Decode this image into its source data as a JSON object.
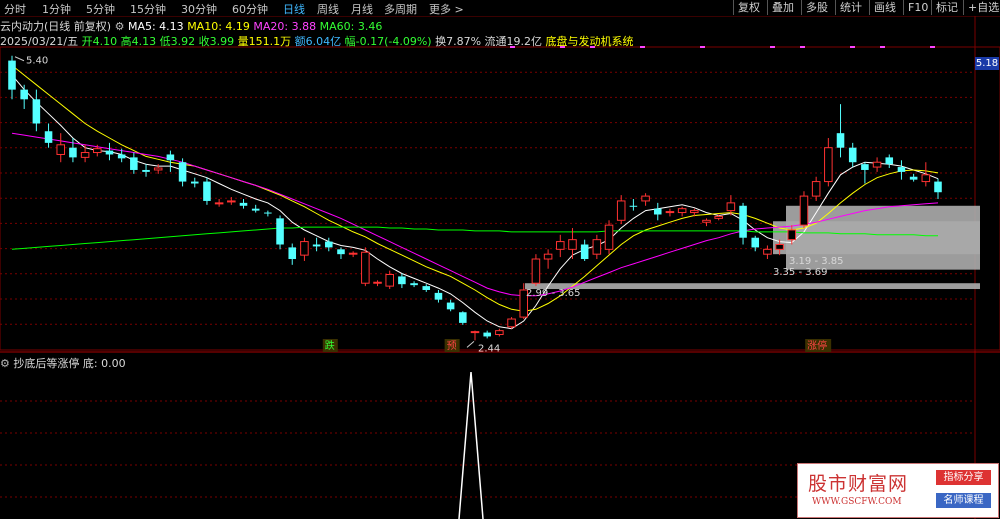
{
  "toolbar": {
    "periods": [
      "分时",
      "1分钟",
      "5分钟",
      "15分钟",
      "30分钟",
      "60分钟",
      "日线",
      "周线",
      "月线",
      "多周期",
      "更多 >"
    ],
    "active_period": "日线",
    "right_buttons": [
      "复权",
      "叠加",
      "多股",
      "统计",
      "画线",
      "F10",
      "标记",
      "+自选"
    ]
  },
  "header": {
    "indicator_name": "云内动力(日线 前复权)",
    "ma5": "MA5: 4.13",
    "ma10": "MA10: 4.19",
    "ma20": "MA20: 3.88",
    "ma60": "MA60: 3.46",
    "date": "2025/03/21/五",
    "open": "开4.10",
    "high": "高4.13",
    "low": "低3.92",
    "close": "收3.99",
    "volume": "量151.1万",
    "amount": "额6.04亿",
    "change": "幅-0.17(-4.09%)",
    "turnover": "换7.87%",
    "float_cap": "流通19.2亿",
    "system_label": "底盘与发动机系统"
  },
  "price_tag": "5.18",
  "annotations": {
    "high_label": "5.40",
    "low_label": "2.44",
    "zone1": "2.99 - 3.65",
    "zone2": "3.19 - 3.85",
    "zone3": "3.35 - 3.69",
    "sig_die": "跌",
    "sig_yu": "预",
    "sig_zhangting": "涨停"
  },
  "sub_panel": {
    "title": "抄底后等涨停",
    "value": "底: 0.00"
  },
  "watermark": {
    "main": "股市财富网",
    "url": "WWW.GSCFW.COM",
    "badge1": "指标分享",
    "badge2": "名师课程"
  },
  "colors": {
    "up": "#ff3232",
    "down": "#54ffff",
    "ma5": "#ffffff",
    "ma10": "#ffff00",
    "ma20": "#ff00ff",
    "ma60": "#00ff00",
    "grid": "#7a0000",
    "active": "#3fb8ff"
  },
  "chart_data": {
    "type": "candlestick",
    "candles": [
      {
        "o": 5.35,
        "h": 5.4,
        "l": 4.95,
        "c": 5.05
      },
      {
        "o": 5.05,
        "h": 5.1,
        "l": 4.85,
        "c": 4.95
      },
      {
        "o": 4.95,
        "h": 5.05,
        "l": 4.62,
        "c": 4.7
      },
      {
        "o": 4.62,
        "h": 4.7,
        "l": 4.45,
        "c": 4.5
      },
      {
        "o": 4.38,
        "h": 4.6,
        "l": 4.3,
        "c": 4.48
      },
      {
        "o": 4.45,
        "h": 4.55,
        "l": 4.3,
        "c": 4.35
      },
      {
        "o": 4.35,
        "h": 4.48,
        "l": 4.3,
        "c": 4.4
      },
      {
        "o": 4.4,
        "h": 4.48,
        "l": 4.36,
        "c": 4.44
      },
      {
        "o": 4.42,
        "h": 4.5,
        "l": 4.32,
        "c": 4.38
      },
      {
        "o": 4.38,
        "h": 4.44,
        "l": 4.3,
        "c": 4.34
      },
      {
        "o": 4.35,
        "h": 4.4,
        "l": 4.18,
        "c": 4.22
      },
      {
        "o": 4.22,
        "h": 4.28,
        "l": 4.15,
        "c": 4.2
      },
      {
        "o": 4.22,
        "h": 4.28,
        "l": 4.18,
        "c": 4.24
      },
      {
        "o": 4.38,
        "h": 4.42,
        "l": 4.2,
        "c": 4.32
      },
      {
        "o": 4.3,
        "h": 4.34,
        "l": 4.05,
        "c": 4.1
      },
      {
        "o": 4.1,
        "h": 4.14,
        "l": 4.04,
        "c": 4.08
      },
      {
        "o": 4.1,
        "h": 4.14,
        "l": 3.86,
        "c": 3.9
      },
      {
        "o": 3.88,
        "h": 3.92,
        "l": 3.84,
        "c": 3.88
      },
      {
        "o": 3.9,
        "h": 3.94,
        "l": 3.86,
        "c": 3.9
      },
      {
        "o": 3.88,
        "h": 3.92,
        "l": 3.82,
        "c": 3.85
      },
      {
        "o": 3.82,
        "h": 3.86,
        "l": 3.78,
        "c": 3.8
      },
      {
        "o": 3.78,
        "h": 3.8,
        "l": 3.74,
        "c": 3.77
      },
      {
        "o": 3.72,
        "h": 3.75,
        "l": 3.4,
        "c": 3.45
      },
      {
        "o": 3.42,
        "h": 3.46,
        "l": 3.24,
        "c": 3.3
      },
      {
        "o": 3.34,
        "h": 3.52,
        "l": 3.28,
        "c": 3.48
      },
      {
        "o": 3.45,
        "h": 3.52,
        "l": 3.38,
        "c": 3.43
      },
      {
        "o": 3.48,
        "h": 3.52,
        "l": 3.38,
        "c": 3.42
      },
      {
        "o": 3.4,
        "h": 3.42,
        "l": 3.3,
        "c": 3.35
      },
      {
        "o": 3.36,
        "h": 3.38,
        "l": 3.32,
        "c": 3.36
      },
      {
        "o": 3.05,
        "h": 3.42,
        "l": 3.02,
        "c": 3.37
      },
      {
        "o": 3.05,
        "h": 3.08,
        "l": 3.02,
        "c": 3.06
      },
      {
        "o": 3.02,
        "h": 3.18,
        "l": 2.99,
        "c": 3.14
      },
      {
        "o": 3.12,
        "h": 3.15,
        "l": 3.0,
        "c": 3.04
      },
      {
        "o": 3.05,
        "h": 3.07,
        "l": 3.01,
        "c": 3.03
      },
      {
        "o": 3.02,
        "h": 3.04,
        "l": 2.96,
        "c": 2.98
      },
      {
        "o": 2.95,
        "h": 2.98,
        "l": 2.85,
        "c": 2.88
      },
      {
        "o": 2.85,
        "h": 2.88,
        "l": 2.76,
        "c": 2.78
      },
      {
        "o": 2.75,
        "h": 2.76,
        "l": 2.62,
        "c": 2.64
      },
      {
        "o": 2.55,
        "h": 2.56,
        "l": 2.46,
        "c": 2.55
      },
      {
        "o": 2.54,
        "h": 2.56,
        "l": 2.48,
        "c": 2.5
      },
      {
        "o": 2.52,
        "h": 2.58,
        "l": 2.5,
        "c": 2.56
      },
      {
        "o": 2.6,
        "h": 2.7,
        "l": 2.58,
        "c": 2.68
      },
      {
        "o": 2.7,
        "h": 3.05,
        "l": 2.68,
        "c": 2.98
      },
      {
        "o": 3.05,
        "h": 3.35,
        "l": 3.02,
        "c": 3.3
      },
      {
        "o": 3.3,
        "h": 3.4,
        "l": 3.2,
        "c": 3.35
      },
      {
        "o": 3.4,
        "h": 3.55,
        "l": 3.32,
        "c": 3.48
      },
      {
        "o": 3.4,
        "h": 3.62,
        "l": 3.3,
        "c": 3.5
      },
      {
        "o": 3.45,
        "h": 3.5,
        "l": 3.28,
        "c": 3.3
      },
      {
        "o": 3.35,
        "h": 3.55,
        "l": 3.3,
        "c": 3.5
      },
      {
        "o": 3.4,
        "h": 3.7,
        "l": 3.35,
        "c": 3.65
      },
      {
        "o": 3.7,
        "h": 3.96,
        "l": 3.66,
        "c": 3.9
      },
      {
        "o": 3.85,
        "h": 3.92,
        "l": 3.8,
        "c": 3.84
      },
      {
        "o": 3.9,
        "h": 3.98,
        "l": 3.85,
        "c": 3.95
      },
      {
        "o": 3.82,
        "h": 3.88,
        "l": 3.7,
        "c": 3.76
      },
      {
        "o": 3.78,
        "h": 3.82,
        "l": 3.74,
        "c": 3.79
      },
      {
        "o": 3.78,
        "h": 3.84,
        "l": 3.74,
        "c": 3.82
      },
      {
        "o": 3.78,
        "h": 3.82,
        "l": 3.74,
        "c": 3.8
      },
      {
        "o": 3.68,
        "h": 3.72,
        "l": 3.64,
        "c": 3.7
      },
      {
        "o": 3.72,
        "h": 3.76,
        "l": 3.7,
        "c": 3.74
      },
      {
        "o": 3.8,
        "h": 3.96,
        "l": 3.75,
        "c": 3.88
      },
      {
        "o": 3.85,
        "h": 3.88,
        "l": 3.45,
        "c": 3.52
      },
      {
        "o": 3.52,
        "h": 3.54,
        "l": 3.38,
        "c": 3.42
      },
      {
        "o": 3.35,
        "h": 3.44,
        "l": 3.3,
        "c": 3.4
      },
      {
        "o": 3.4,
        "h": 3.5,
        "l": 3.34,
        "c": 3.45
      },
      {
        "o": 3.5,
        "h": 3.65,
        "l": 3.45,
        "c": 3.6
      },
      {
        "o": 3.65,
        "h": 4.0,
        "l": 3.62,
        "c": 3.95
      },
      {
        "o": 3.95,
        "h": 4.15,
        "l": 3.9,
        "c": 4.1
      },
      {
        "o": 4.1,
        "h": 4.55,
        "l": 4.05,
        "c": 4.45
      },
      {
        "o": 4.6,
        "h": 4.9,
        "l": 4.35,
        "c": 4.45
      },
      {
        "o": 4.45,
        "h": 4.5,
        "l": 4.25,
        "c": 4.3
      },
      {
        "o": 4.28,
        "h": 4.3,
        "l": 4.08,
        "c": 4.22
      },
      {
        "o": 4.25,
        "h": 4.35,
        "l": 4.2,
        "c": 4.3
      },
      {
        "o": 4.35,
        "h": 4.38,
        "l": 4.24,
        "c": 4.28
      },
      {
        "o": 4.25,
        "h": 4.32,
        "l": 4.12,
        "c": 4.2
      },
      {
        "o": 4.15,
        "h": 4.18,
        "l": 4.1,
        "c": 4.12
      },
      {
        "o": 4.1,
        "h": 4.3,
        "l": 4.05,
        "c": 4.17
      },
      {
        "o": 4.1,
        "h": 4.13,
        "l": 3.92,
        "c": 3.99
      }
    ],
    "ma_series": [
      {
        "name": "MA5",
        "values": [
          5.2,
          5.05,
          4.92,
          4.8,
          4.68,
          4.55,
          4.45,
          4.42,
          4.41,
          4.38,
          4.32,
          4.28,
          4.26,
          4.26,
          4.22,
          4.18,
          4.14,
          4.08,
          4.02,
          3.97,
          3.92,
          3.88,
          3.8,
          3.68,
          3.6,
          3.54,
          3.48,
          3.44,
          3.42,
          3.39,
          3.3,
          3.22,
          3.15,
          3.1,
          3.05,
          3.0,
          2.94,
          2.85,
          2.75,
          2.66,
          2.6,
          2.58,
          2.66,
          2.82,
          3.02,
          3.2,
          3.34,
          3.4,
          3.44,
          3.5,
          3.62,
          3.72,
          3.8,
          3.82,
          3.84,
          3.86,
          3.83,
          3.78,
          3.75,
          3.77,
          3.7,
          3.6,
          3.52,
          3.48,
          3.47,
          3.58,
          3.78,
          3.98,
          4.17,
          4.25,
          4.3,
          4.29,
          4.28,
          4.26,
          4.22,
          4.18,
          4.13
        ]
      },
      {
        "name": "MA10",
        "values": [
          5.3,
          5.2,
          5.1,
          5.0,
          4.9,
          4.8,
          4.7,
          4.62,
          4.55,
          4.48,
          4.42,
          4.36,
          4.33,
          4.3,
          4.28,
          4.26,
          4.22,
          4.18,
          4.14,
          4.1,
          4.06,
          4.01,
          3.96,
          3.9,
          3.84,
          3.77,
          3.7,
          3.64,
          3.58,
          3.53,
          3.46,
          3.4,
          3.34,
          3.28,
          3.22,
          3.17,
          3.12,
          3.05,
          2.98,
          2.9,
          2.83,
          2.78,
          2.76,
          2.78,
          2.84,
          2.92,
          3.02,
          3.12,
          3.23,
          3.34,
          3.45,
          3.54,
          3.6,
          3.64,
          3.68,
          3.72,
          3.75,
          3.76,
          3.77,
          3.78,
          3.76,
          3.72,
          3.67,
          3.62,
          3.6,
          3.62,
          3.67,
          3.77,
          3.88,
          3.98,
          4.07,
          4.14,
          4.18,
          4.21,
          4.22,
          4.21,
          4.19
        ]
      },
      {
        "name": "MA20",
        "values": [
          4.6,
          4.58,
          4.56,
          4.54,
          4.52,
          4.5,
          4.48,
          4.46,
          4.44,
          4.42,
          4.4,
          4.38,
          4.36,
          4.33,
          4.3,
          4.26,
          4.22,
          4.18,
          4.14,
          4.1,
          4.06,
          4.02,
          3.97,
          3.92,
          3.87,
          3.82,
          3.77,
          3.72,
          3.66,
          3.6,
          3.54,
          3.48,
          3.42,
          3.36,
          3.3,
          3.24,
          3.18,
          3.12,
          3.06,
          3.0,
          2.96,
          2.93,
          2.92,
          2.92,
          2.94,
          2.97,
          3.01,
          3.06,
          3.11,
          3.16,
          3.21,
          3.25,
          3.29,
          3.33,
          3.37,
          3.41,
          3.45,
          3.49,
          3.52,
          3.56,
          3.59,
          3.61,
          3.62,
          3.63,
          3.64,
          3.66,
          3.68,
          3.71,
          3.74,
          3.77,
          3.8,
          3.82,
          3.84,
          3.85,
          3.86,
          3.87,
          3.88
        ]
      },
      {
        "name": "MA60",
        "values": [
          3.4,
          3.41,
          3.42,
          3.43,
          3.44,
          3.45,
          3.46,
          3.47,
          3.48,
          3.49,
          3.5,
          3.51,
          3.52,
          3.53,
          3.54,
          3.55,
          3.56,
          3.57,
          3.58,
          3.59,
          3.6,
          3.61,
          3.62,
          3.62,
          3.63,
          3.63,
          3.63,
          3.63,
          3.63,
          3.63,
          3.63,
          3.62,
          3.62,
          3.61,
          3.61,
          3.6,
          3.6,
          3.6,
          3.59,
          3.59,
          3.59,
          3.58,
          3.58,
          3.58,
          3.58,
          3.58,
          3.58,
          3.58,
          3.58,
          3.59,
          3.59,
          3.59,
          3.59,
          3.59,
          3.59,
          3.59,
          3.59,
          3.59,
          3.59,
          3.59,
          3.59,
          3.58,
          3.58,
          3.58,
          3.58,
          3.57,
          3.57,
          3.57,
          3.56,
          3.56,
          3.56,
          3.55,
          3.55,
          3.55,
          3.55,
          3.54,
          3.54
        ]
      }
    ],
    "boxes": [
      {
        "lo": 2.99,
        "hi": 3.05
      },
      {
        "lo": 3.19,
        "hi": 3.85
      },
      {
        "lo": 3.35,
        "hi": 3.69
      }
    ],
    "spike": {
      "index": 38,
      "value": 1
    }
  }
}
